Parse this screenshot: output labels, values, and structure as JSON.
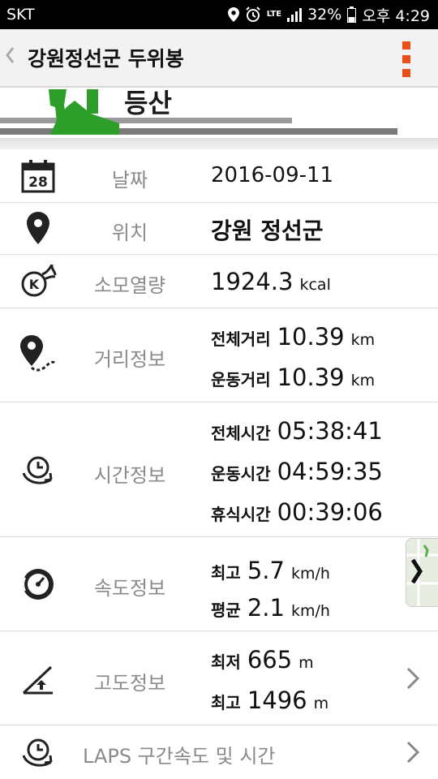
{
  "status_bar": {
    "carrier": "SKT",
    "lte": "LTE",
    "battery": "32%",
    "time": "오후 4:29"
  },
  "app_bar": {
    "title": "강원정선군 두위봉"
  },
  "banner": {
    "title": "등산"
  },
  "rows": {
    "date": {
      "label": "날짜",
      "value": "2016-09-11"
    },
    "location": {
      "label": "위치",
      "value": "강원 정선군"
    },
    "calories": {
      "label": "소모열량",
      "value": "1924.3",
      "unit": "kcal"
    },
    "distance": {
      "label": "거리정보",
      "lines": [
        {
          "label": "전체거리",
          "value": "10.39",
          "unit": "km"
        },
        {
          "label": "운동거리",
          "value": "10.39",
          "unit": "km"
        }
      ]
    },
    "time": {
      "label": "시간정보",
      "lines": [
        {
          "label": "전체시간",
          "value": "05:38:41"
        },
        {
          "label": "운동시간",
          "value": "04:59:35"
        },
        {
          "label": "휴식시간",
          "value": "00:39:06"
        }
      ]
    },
    "speed": {
      "label": "속도정보",
      "lines": [
        {
          "label": "최고",
          "value": "5.7",
          "unit": "km/h"
        },
        {
          "label": "평균",
          "value": "2.1",
          "unit": "km/h"
        }
      ]
    },
    "altitude": {
      "label": "고도정보",
      "lines": [
        {
          "label": "최저",
          "value": "665",
          "unit": "m"
        },
        {
          "label": "최고",
          "value": "1496",
          "unit": "m"
        }
      ]
    },
    "laps": {
      "label": "LAPS 구간속도 및 시간"
    }
  },
  "calendar_day": "28",
  "calorie_badge": "K",
  "colors": {
    "accent": "#e8501a",
    "banner_green": "#2e9e2a",
    "label_gray": "#8a8a8a"
  },
  "icons": [
    "back-icon",
    "menu-icon",
    "calendar-icon",
    "location-pin-icon",
    "calorie-flame-icon",
    "route-pin-icon",
    "clock-cycle-icon",
    "speedometer-icon",
    "altitude-icon",
    "chevron-right-icon"
  ]
}
